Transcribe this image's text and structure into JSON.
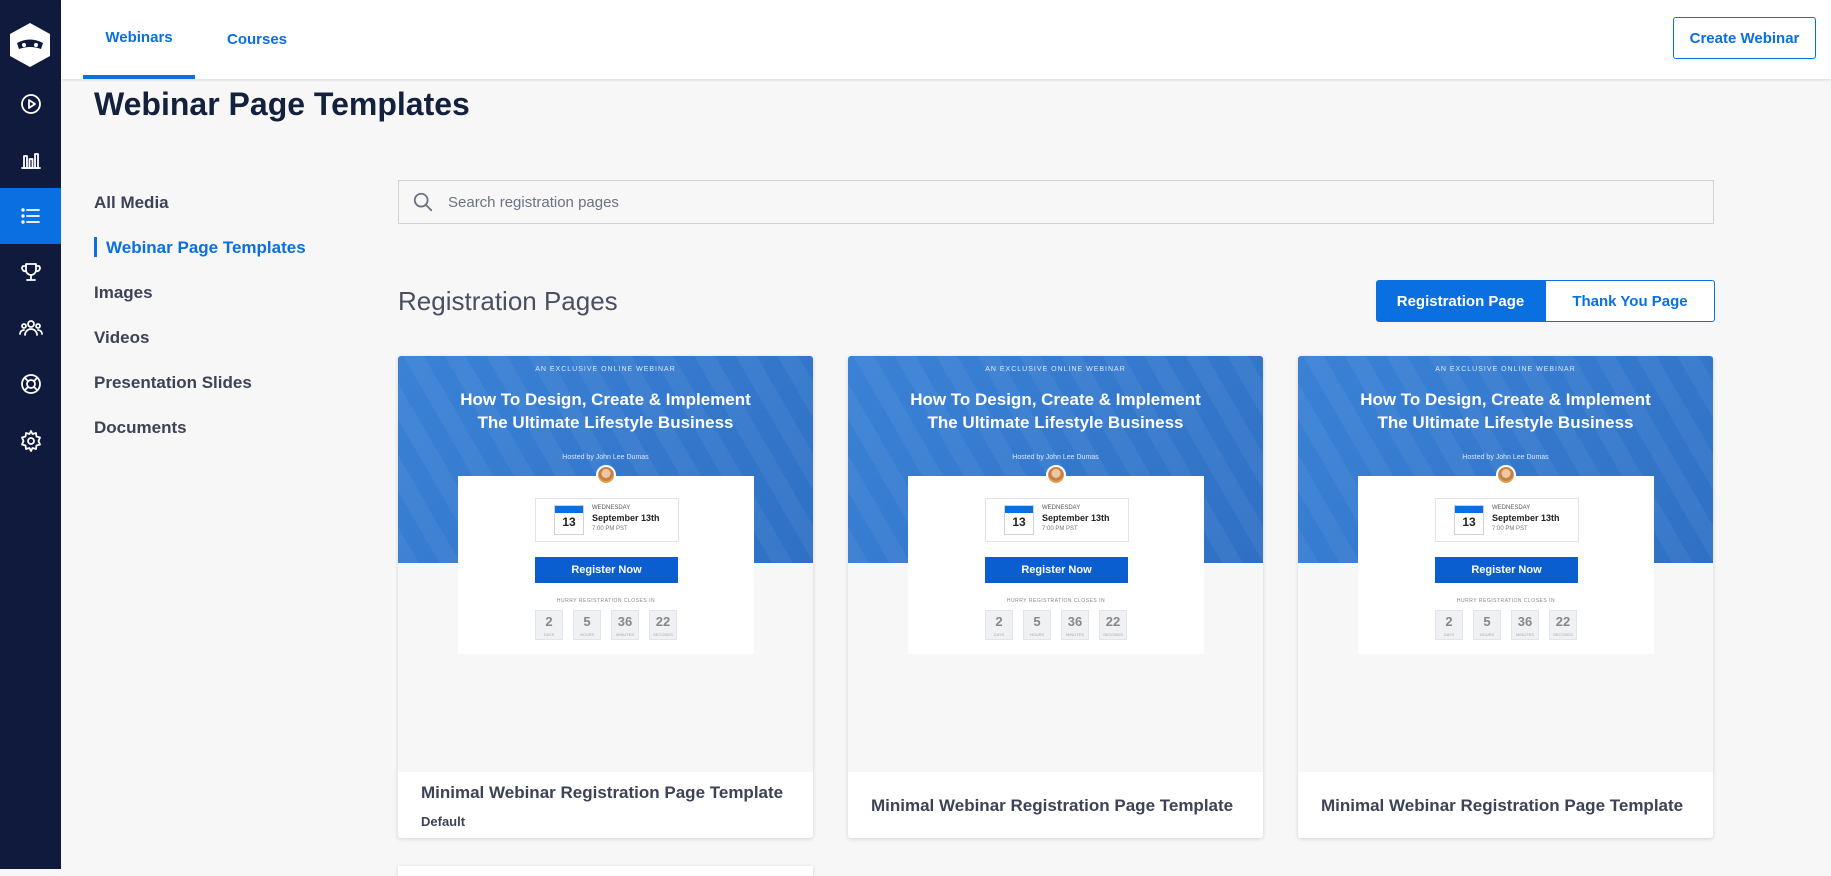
{
  "rail": {
    "items": [
      {
        "icon": "play-circle-icon",
        "active": false
      },
      {
        "icon": "bar-chart-icon",
        "active": false
      },
      {
        "icon": "list-icon",
        "active": true
      },
      {
        "icon": "trophy-icon",
        "active": false
      },
      {
        "icon": "users-icon",
        "active": false
      },
      {
        "icon": "lifebuoy-icon",
        "active": false
      },
      {
        "icon": "gear-icon",
        "active": false
      }
    ]
  },
  "topbar": {
    "tabs": [
      {
        "label": "Webinars",
        "active": true
      },
      {
        "label": "Courses",
        "active": false
      }
    ],
    "create_button": "Create Webinar"
  },
  "page_title": "Webinar Page Templates",
  "subnav": {
    "items": [
      {
        "label": "All Media",
        "active": false
      },
      {
        "label": "Webinar Page Templates",
        "active": true
      },
      {
        "label": "Images",
        "active": false
      },
      {
        "label": "Videos",
        "active": false
      },
      {
        "label": "Presentation Slides",
        "active": false
      },
      {
        "label": "Documents",
        "active": false
      }
    ]
  },
  "search": {
    "placeholder": "Search registration pages",
    "value": ""
  },
  "section": {
    "title": "Registration Pages",
    "toggle": {
      "selected": "Registration Page",
      "other": "Thank You Page"
    }
  },
  "thumbnail": {
    "kicker": "AN EXCLUSIVE ONLINE WEBINAR",
    "headline_line1": "How To  Design, Create & Implement",
    "headline_line2": "The Ultimate Lifestyle Business",
    "host": "Hosted by John Lee Dumas",
    "cal_label": "SEPTEMBER",
    "cal_day": "13",
    "weekday": "WEDNESDAY",
    "date": "September 13th",
    "time": "7:00 PM PST",
    "register_button": "Register Now",
    "hurry": "HURRY REGISTRATION CLOSES IN",
    "countdown": [
      {
        "value": "2",
        "unit": "DAYS"
      },
      {
        "value": "5",
        "unit": "HOURS"
      },
      {
        "value": "36",
        "unit": "MINUTES"
      },
      {
        "value": "22",
        "unit": "SECONDS"
      }
    ]
  },
  "templates": [
    {
      "title": "Minimal Webinar Registration Page Template",
      "subtitle": "Default"
    },
    {
      "title": "Minimal Webinar Registration Page Template",
      "subtitle": ""
    },
    {
      "title": "Minimal Webinar Registration Page Template",
      "subtitle": ""
    }
  ],
  "colors": {
    "accent": "#0a6fe0",
    "rail": "#0f1a3d",
    "hero": "#3a82d6"
  }
}
